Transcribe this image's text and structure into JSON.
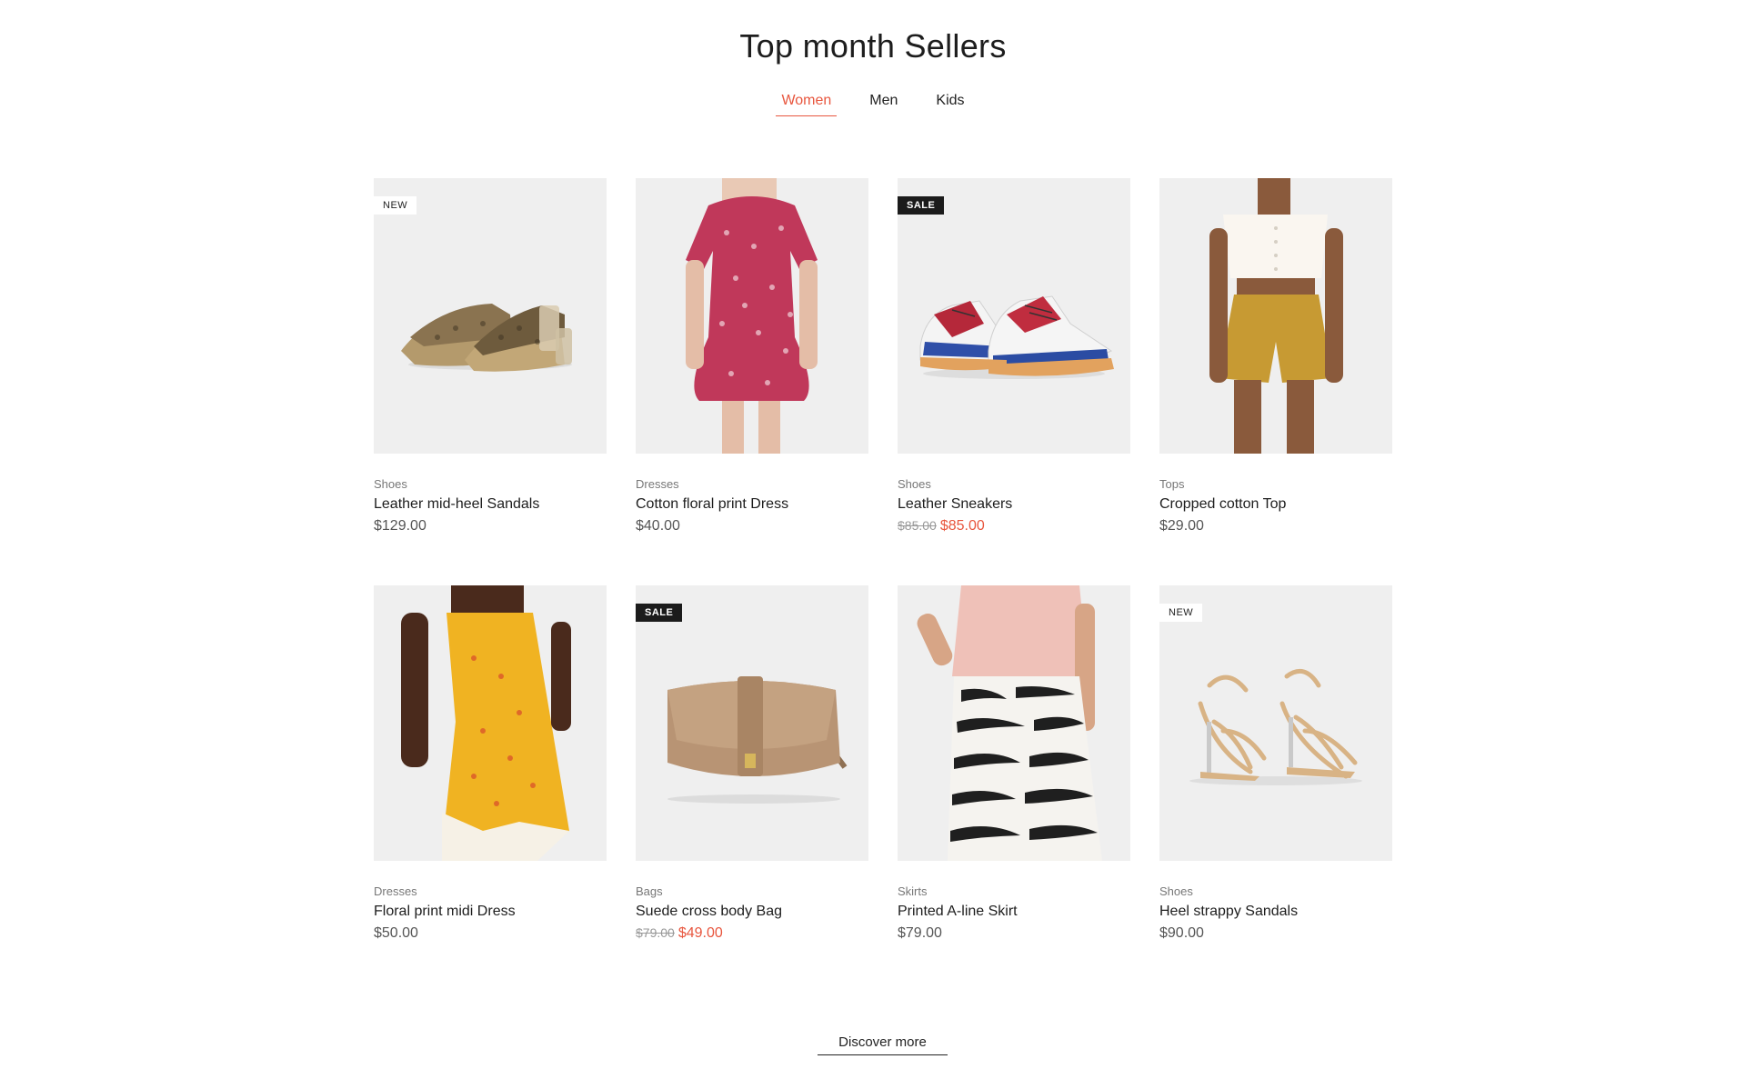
{
  "title": "Top month Sellers",
  "tabs": [
    {
      "label": "Women",
      "active": true
    },
    {
      "label": "Men",
      "active": false
    },
    {
      "label": "Kids",
      "active": false
    }
  ],
  "products": [
    {
      "category": "Shoes",
      "name": "Leather mid-heel Sandals",
      "price": "$129.00",
      "old_price": "",
      "badge": "NEW",
      "image": "snakeskin-mules"
    },
    {
      "category": "Dresses",
      "name": "Cotton floral print Dress",
      "price": "$40.00",
      "old_price": "",
      "badge": "",
      "image": "floral-dress"
    },
    {
      "category": "Shoes",
      "name": "Leather Sneakers",
      "price": "$85.00",
      "old_price": "$85.00",
      "badge": "SALE",
      "image": "sneakers"
    },
    {
      "category": "Tops",
      "name": "Cropped cotton Top",
      "price": "$29.00",
      "old_price": "",
      "badge": "",
      "image": "cropped-top"
    },
    {
      "category": "Dresses",
      "name": "Floral print midi Dress",
      "price": "$50.00",
      "old_price": "",
      "badge": "",
      "image": "yellow-dress"
    },
    {
      "category": "Bags",
      "name": "Suede cross body Bag",
      "price": "$49.00",
      "old_price": "$79.00",
      "badge": "SALE",
      "image": "crossbody-bag"
    },
    {
      "category": "Skirts",
      "name": "Printed A-line Skirt",
      "price": "$79.00",
      "old_price": "",
      "badge": "",
      "image": "zebra-skirt"
    },
    {
      "category": "Shoes",
      "name": "Heel strappy Sandals",
      "price": "$90.00",
      "old_price": "",
      "badge": "NEW",
      "image": "strappy-sandals"
    }
  ],
  "discover_label": "Discover more",
  "colors": {
    "accent": "#e8563e",
    "sale_badge": "#1b1b1b",
    "thumb_bg": "#efefef"
  }
}
